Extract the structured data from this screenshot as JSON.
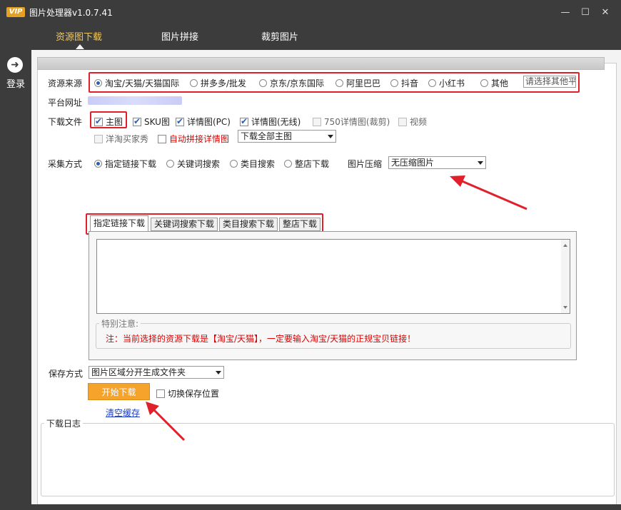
{
  "window": {
    "badge": "VIP",
    "title": "图片处理器v1.0.7.41",
    "minimize": "—",
    "maximize": "☐",
    "close": "✕"
  },
  "top_tabs": [
    "资源图下载",
    "图片拼接",
    "裁剪图片"
  ],
  "sidebar": {
    "login_label": "登录"
  },
  "source": {
    "label": "资源来源",
    "options": [
      "淘宝/天猫/天猫国际",
      "拼多多/批发",
      "京东/京东国际",
      "阿里巴巴",
      "抖音",
      "小红书",
      "其他"
    ],
    "selected": 0,
    "other_placeholder": "请选择其他平"
  },
  "platform_url": {
    "label": "平台网址"
  },
  "download_files": {
    "label": "下载文件",
    "items": [
      {
        "label": "主图",
        "checked": true
      },
      {
        "label": "SKU图",
        "checked": true
      },
      {
        "label": "详情图(PC)",
        "checked": true
      },
      {
        "label": "详情图(无线)",
        "checked": true
      },
      {
        "label": "750详情图(裁剪)",
        "checked": false
      },
      {
        "label": "视频",
        "checked": false
      }
    ],
    "row2": [
      {
        "label": "洋淘买家秀",
        "checked": false
      },
      {
        "label": "自动拼接详情图",
        "checked": false
      }
    ],
    "main_image_select": "下载全部主图"
  },
  "collect_method": {
    "label": "采集方式",
    "options": [
      "指定链接下载",
      "关键词搜索",
      "类目搜索",
      "整店下载"
    ],
    "selected": 0,
    "compress_label": "图片压缩",
    "compress_value": "无压缩图片"
  },
  "inner_tabs": [
    "指定链接下载",
    "关键词搜索下载",
    "类目搜索下载",
    "整店下载"
  ],
  "notice": {
    "legend": "特别注意:",
    "text": "注：当前选择的资源下载是【淘宝/天猫】，一定要输入淘宝/天猫的正规宝贝链接！"
  },
  "save_method": {
    "label": "保存方式",
    "value": "图片区域分开生成文件夹"
  },
  "actions": {
    "start": "开始下载",
    "switch_save": "切换保存位置",
    "clear_cache": "清空缓存"
  },
  "log": {
    "legend": "下载日志"
  },
  "colors": {
    "accent": "#f5a32a",
    "annotation": "#e0202a",
    "titlebar": "#3c3c3c"
  }
}
